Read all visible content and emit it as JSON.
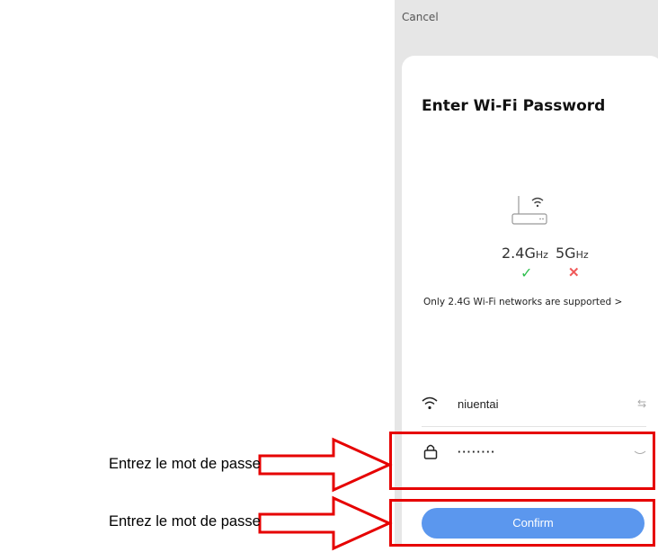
{
  "header": {
    "cancel_label": "Cancel"
  },
  "dialog": {
    "title": "Enter Wi-Fi Password",
    "band_24": "2.4G",
    "band_5": "5G",
    "band_unit": "Hz",
    "note": "Only 2.4G Wi-Fi networks are supported >",
    "ssid": "niuentai",
    "password_masked": "········",
    "confirm_label": "Confirm"
  },
  "annotations": {
    "caption_1": "Entrez le mot de passe",
    "caption_2": "Entrez le mot de passe",
    "highlight_color": "#e60000"
  },
  "colors": {
    "accent": "#5b97ee",
    "check": "#2fbf4f",
    "cross": "#f05a5a"
  },
  "icons": [
    "router-icon",
    "wifi-icon",
    "lock-icon",
    "swap-icon",
    "eye-closed-icon",
    "check-icon",
    "cross-icon",
    "arrow-icon"
  ]
}
